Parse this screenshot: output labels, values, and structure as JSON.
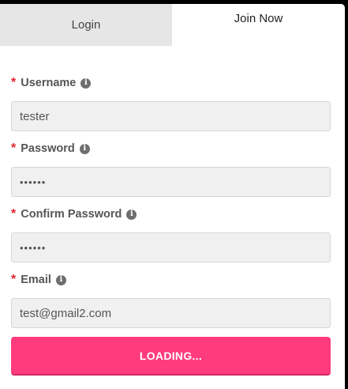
{
  "tabs": [
    {
      "label": "Login",
      "active": false
    },
    {
      "label": "Join Now",
      "active": true
    }
  ],
  "form": {
    "required_mark": "*",
    "fields": [
      {
        "label": "Username",
        "value": "tester",
        "type": "text"
      },
      {
        "label": "Password",
        "value": "••••••",
        "type": "password"
      },
      {
        "label": "Confirm Password",
        "value": "••••••",
        "type": "password"
      },
      {
        "label": "Email",
        "value": "test@gmail2.com",
        "type": "text"
      }
    ],
    "info_glyph": "i",
    "submit_label": "LOADING..."
  },
  "colors": {
    "accent": "#ff3b7e",
    "required": "#e0242f",
    "tab_inactive_bg": "#e6e6e6"
  }
}
